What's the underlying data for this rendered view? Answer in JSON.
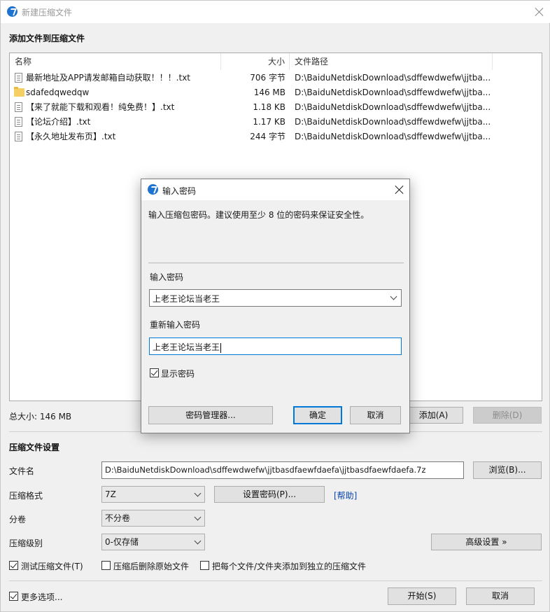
{
  "window": {
    "title": "新建压缩文件",
    "section_add": "添加文件到压缩文件"
  },
  "filelist": {
    "columns": [
      "名称",
      "大小",
      "文件路径"
    ],
    "rows": [
      {
        "name": "最新地址及APP请发邮箱自动获取！！！.txt",
        "size": "706 字节",
        "path": "D:\\BaiduNetdiskDownload\\sdffewdwefw\\jjtba...",
        "icon": "text-file-icon"
      },
      {
        "name": "sdafedqwedqw",
        "size": "146 MB",
        "path": "D:\\BaiduNetdiskDownload\\sdffewdwefw\\jjtba...",
        "icon": "folder-icon"
      },
      {
        "name": "【来了就能下载和观看！纯免费！】.txt",
        "size": "1.18 KB",
        "path": "D:\\BaiduNetdiskDownload\\sdffewdwefw\\jjtba...",
        "icon": "text-file-icon"
      },
      {
        "name": "【论坛介绍】.txt",
        "size": "1.17 KB",
        "path": "D:\\BaiduNetdiskDownload\\sdffewdwefw\\jjtba...",
        "icon": "text-file-icon"
      },
      {
        "name": "【永久地址发布页】.txt",
        "size": "244 字节",
        "path": "D:\\BaiduNetdiskDownload\\sdffewdwefw\\jjtba...",
        "icon": "text-file-icon"
      }
    ]
  },
  "summary": {
    "total_size": "总大小: 146 MB",
    "add_label": "添加(A)",
    "delete_label": "删除(D)"
  },
  "settings": {
    "section": "压缩文件设置",
    "filename_label": "文件名",
    "filename_value": "D:\\BaiduNetdiskDownload\\sdffewdwefw\\jjtbasdfaewfdaefa\\jjtbasdfaewfdaefa.7z",
    "browse_label": "浏览(B)...",
    "format_label": "压缩格式",
    "format_value": "7Z",
    "set_password_label": "设置密码(P)...",
    "help_label": "[帮助]",
    "split_label": "分卷",
    "split_value": "不分卷",
    "level_label": "压缩级别",
    "level_value": "0-仅存储",
    "advanced_label": "高级设置 »",
    "test_label": "测试压缩文件(T)",
    "delete_after_label": "压缩后删除原始文件",
    "separate_label": "把每个文件/文件夹添加到独立的压缩文件",
    "more_options_label": "更多选项...",
    "start_label": "开始(S)",
    "cancel_label": "取消"
  },
  "dialog": {
    "title": "输入密码",
    "description": "输入压缩包密码。建议使用至少 8 位的密码来保证安全性。",
    "password_label": "输入密码",
    "password_value": "上老王论坛当老王",
    "reenter_label": "重新输入密码",
    "reenter_value": "上老王论坛当老王",
    "show_password_label": "显示密码",
    "manager_label": "密码管理器...",
    "ok_label": "确定",
    "cancel_label": "取消"
  },
  "colors": {
    "accent": "#0078d7",
    "app_icon": "#1e72d0",
    "link": "#0645ad"
  }
}
